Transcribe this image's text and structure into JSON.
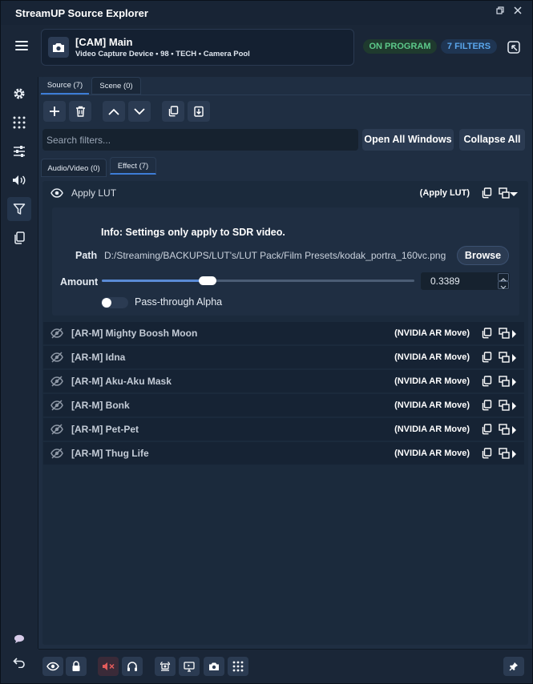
{
  "window": {
    "title": "StreamUP Source Explorer",
    "restore_icon": "restore-icon",
    "close_icon": "close-icon"
  },
  "header": {
    "source_name": "[CAM] Main",
    "source_meta": "Video Capture Device  •  98 • TECH • Camera Pool",
    "badge_program": "ON PROGRAM",
    "badge_filters": "7 FILTERS",
    "colors": {
      "program": "#5cc989",
      "filters": "#5aa6ec"
    }
  },
  "sidebar": {
    "items": [
      {
        "name": "settings",
        "icon": "gear-icon"
      },
      {
        "name": "grid",
        "icon": "grid-dots-icon"
      },
      {
        "name": "mixer",
        "icon": "sliders-icon"
      },
      {
        "name": "audio",
        "icon": "speaker-icon"
      },
      {
        "name": "filters",
        "icon": "filter-icon",
        "active": true
      },
      {
        "name": "copy",
        "icon": "copy-icon"
      }
    ],
    "chat_icon": "chat-bubble-icon",
    "back_icon": "back-arrow-icon"
  },
  "tabs": {
    "source": "Source (7)",
    "scene": "Scene (0)"
  },
  "toolbar": {
    "add_icon": "plus-icon",
    "delete_icon": "trash-icon",
    "up_icon": "chevron-up-icon",
    "down_icon": "chevron-down-icon",
    "copy_icon": "copy-icon",
    "paste_icon": "paste-icon"
  },
  "search": {
    "placeholder": "Search filters...",
    "value": ""
  },
  "buttons": {
    "open_all": "Open All Windows",
    "collapse_all": "Collapse All"
  },
  "subtabs": {
    "audio_video": "Audio/Video (0)",
    "effect": "Effect (7)"
  },
  "expanded_filter": {
    "name": "Apply LUT",
    "type": "(Apply LUT)",
    "info": "Info: Settings only apply to SDR video.",
    "path_label": "Path",
    "path_value": "D:/Streaming/BACKUPS/LUT's/LUT Pack/Film Presets/kodak_portra_160vc.png",
    "browse_label": "Browse",
    "amount_label": "Amount",
    "amount_value": "0.3389",
    "amount_fraction": 0.3389,
    "passthrough_label": "Pass-through Alpha",
    "passthrough_enabled": false
  },
  "filters": [
    {
      "name": "[AR-M] Mighty Boosh Moon",
      "type": "(NVIDIA AR Move)"
    },
    {
      "name": "[AR-M] Idna",
      "type": "(NVIDIA AR Move)"
    },
    {
      "name": "[AR-M] Aku-Aku Mask",
      "type": "(NVIDIA AR Move)"
    },
    {
      "name": "[AR-M] Bonk",
      "type": "(NVIDIA AR Move)"
    },
    {
      "name": "[AR-M] Pet-Pet",
      "type": "(NVIDIA AR Move)"
    },
    {
      "name": "[AR-M] Thug Life",
      "type": "(NVIDIA AR Move)"
    }
  ],
  "bottombar": {
    "icons": [
      "eye-icon",
      "lock-icon",
      "mute-icon",
      "headphones-icon",
      "alert-icon",
      "display-icon",
      "camera-icon",
      "grid-dots-icon"
    ],
    "pin_icon": "pin-icon"
  }
}
